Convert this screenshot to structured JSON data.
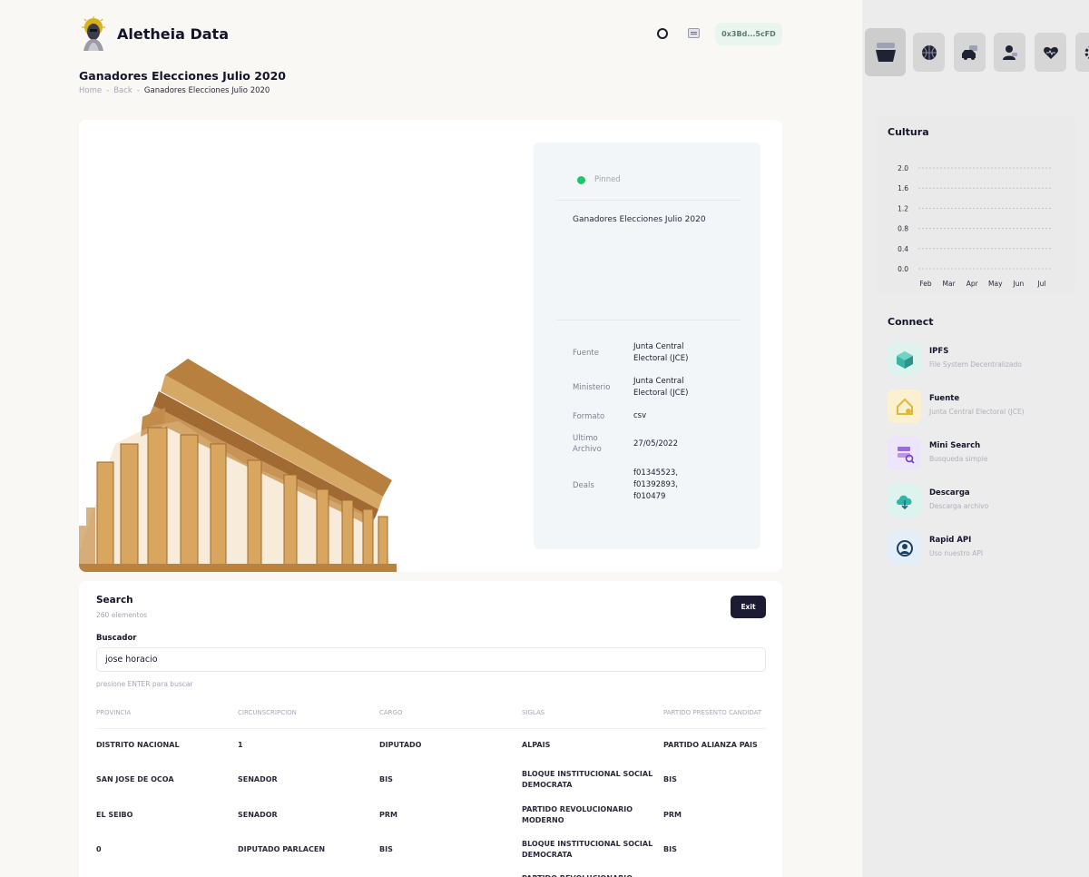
{
  "app": {
    "title": "Aletheia Data",
    "wallet": "0x3Bd...5cFD"
  },
  "page": {
    "title": "Ganadores Elecciones Julio 2020",
    "breadcrumb": {
      "home": "Home",
      "sep": "-",
      "back": "Back",
      "current": "Ganadores Elecciones Julio 2020"
    }
  },
  "info": {
    "status": "Pinned",
    "description": "Ganadores Elecciones Julio 2020",
    "properties": [
      {
        "key": "Fuente",
        "value": "Junta Central Electoral (JCE)"
      },
      {
        "key": "Ministerio",
        "value": "Junta Central Electoral (JCE)"
      },
      {
        "key": "Formato",
        "value": "csv"
      },
      {
        "key": "Ultimo Archivo",
        "value": "27/05/2022"
      },
      {
        "key": "Deals",
        "value": "f01345523, f01392893, f010479"
      }
    ]
  },
  "search": {
    "title": "Search",
    "count": "260 elementos",
    "exit_label": "Exit",
    "field_label": "Buscador",
    "value": "jose horacio",
    "hint": "presione ENTER para buscar",
    "columns": [
      "PROVINCIA",
      "CIRCUNSCRIPCION",
      "CARGO",
      "SIGLAS",
      "PARTIDO PRESENTO CANDIDAT"
    ],
    "rows": [
      [
        "DISTRITO NACIONAL",
        "1",
        "DIPUTADO",
        "ALPAIS",
        "PARTIDO ALIANZA PAIS"
      ],
      [
        "SAN JOSE DE OCOA",
        "SENADOR",
        "BIS",
        "BLOQUE INSTITUCIONAL SOCIAL DEMOCRATA",
        "BIS"
      ],
      [
        "EL SEIBO",
        "SENADOR",
        "PRM",
        "PARTIDO REVOLUCIONARIO MODERNO",
        "PRM"
      ],
      [
        "0",
        "DIPUTADO PARLACEN",
        "BIS",
        "BLOQUE INSTITUCIONAL SOCIAL DEMOCRATA",
        "BIS"
      ],
      [
        "",
        "",
        "",
        "PARTIDO REVOLUCIONARIO",
        ""
      ]
    ]
  },
  "sidebar": {
    "tabs": [
      "basket-icon",
      "basketball-icon",
      "car-icon",
      "user-icon",
      "heart-icon",
      "gear-icon"
    ],
    "chart_title": "Cultura",
    "connect_title": "Connect",
    "connect": [
      {
        "title": "IPFS",
        "subtitle": "File System Decentralizado",
        "icon": "cube-icon",
        "bg": "#dff3ee",
        "fg": "#3bb3a5"
      },
      {
        "title": "Fuente",
        "subtitle": "Junta Central Electoral (JCE)",
        "icon": "house-icon",
        "bg": "#fbf1d0",
        "fg": "#e2b735"
      },
      {
        "title": "Mini Search",
        "subtitle": "Busqueda simple",
        "icon": "search-server-icon",
        "bg": "#ede6fa",
        "fg": "#9a6cdb"
      },
      {
        "title": "Descarga",
        "subtitle": "Descarga archivo",
        "icon": "cloud-download-icon",
        "bg": "#ddf3ee",
        "fg": "#2fb6a6"
      },
      {
        "title": "Rapid API",
        "subtitle": "Uso nuestro API",
        "icon": "api-icon",
        "bg": "#e4eef8",
        "fg": "#2b5e93"
      }
    ]
  },
  "chart_data": {
    "type": "line",
    "title": "Cultura",
    "categories": [
      "Feb",
      "Mar",
      "Apr",
      "May",
      "Jun",
      "Jul"
    ],
    "y_ticks": [
      "2.0",
      "1.6",
      "1.2",
      "0.8",
      "0.4",
      "0.0"
    ],
    "ylim": [
      0,
      2.0
    ],
    "grid": true,
    "series": []
  }
}
